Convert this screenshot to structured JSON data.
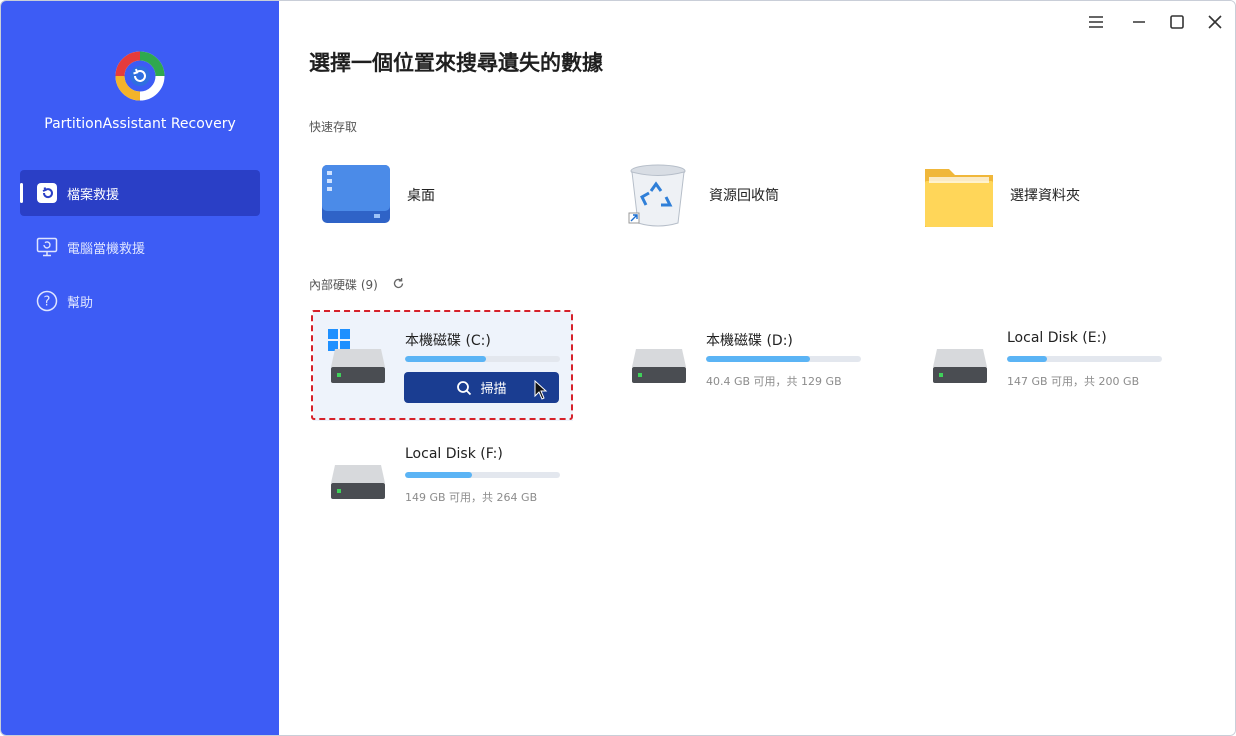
{
  "app": {
    "name": "PartitionAssistant Recovery"
  },
  "sidebar": {
    "items": [
      {
        "label": "檔案救援",
        "icon": "file-restore-icon",
        "active": true
      },
      {
        "label": "電腦當機救援",
        "icon": "monitor-icon",
        "active": false
      },
      {
        "label": "幫助",
        "icon": "help-icon",
        "active": false
      }
    ]
  },
  "window_controls": [
    "menu-icon",
    "minimize-icon",
    "maximize-icon",
    "close-icon"
  ],
  "main": {
    "title": "選擇一個位置來搜尋遺失的數據",
    "quick_access": {
      "label": "快速存取",
      "items": [
        {
          "label": "桌面",
          "icon": "desktop-icon"
        },
        {
          "label": "資源回收筒",
          "icon": "recycle-bin-icon"
        },
        {
          "label": "選擇資料夾",
          "icon": "folder-icon"
        }
      ]
    },
    "internal_disks": {
      "label": "內部硬碟 (9)",
      "disks": [
        {
          "name": "本機磁碟 (C:)",
          "info": "",
          "used_fraction": 0.52,
          "system": true,
          "scan_label": "掃描"
        },
        {
          "name": "本機磁碟 (D:)",
          "info": "40.4 GB 可用，共 129 GB",
          "used_fraction": 0.67
        },
        {
          "name": "Local Disk (E:)",
          "info": "147 GB 可用，共 200 GB",
          "used_fraction": 0.26
        },
        {
          "name": "Local Disk (F:)",
          "info": "149 GB 可用，共 264 GB",
          "used_fraction": 0.43
        }
      ]
    }
  },
  "colors": {
    "sidebar": "#3d5cf5",
    "active_nav": "#2a3fc6",
    "scan_button": "#1a3d91",
    "progress": "#5bb4f5",
    "highlight": "#d6212a"
  }
}
